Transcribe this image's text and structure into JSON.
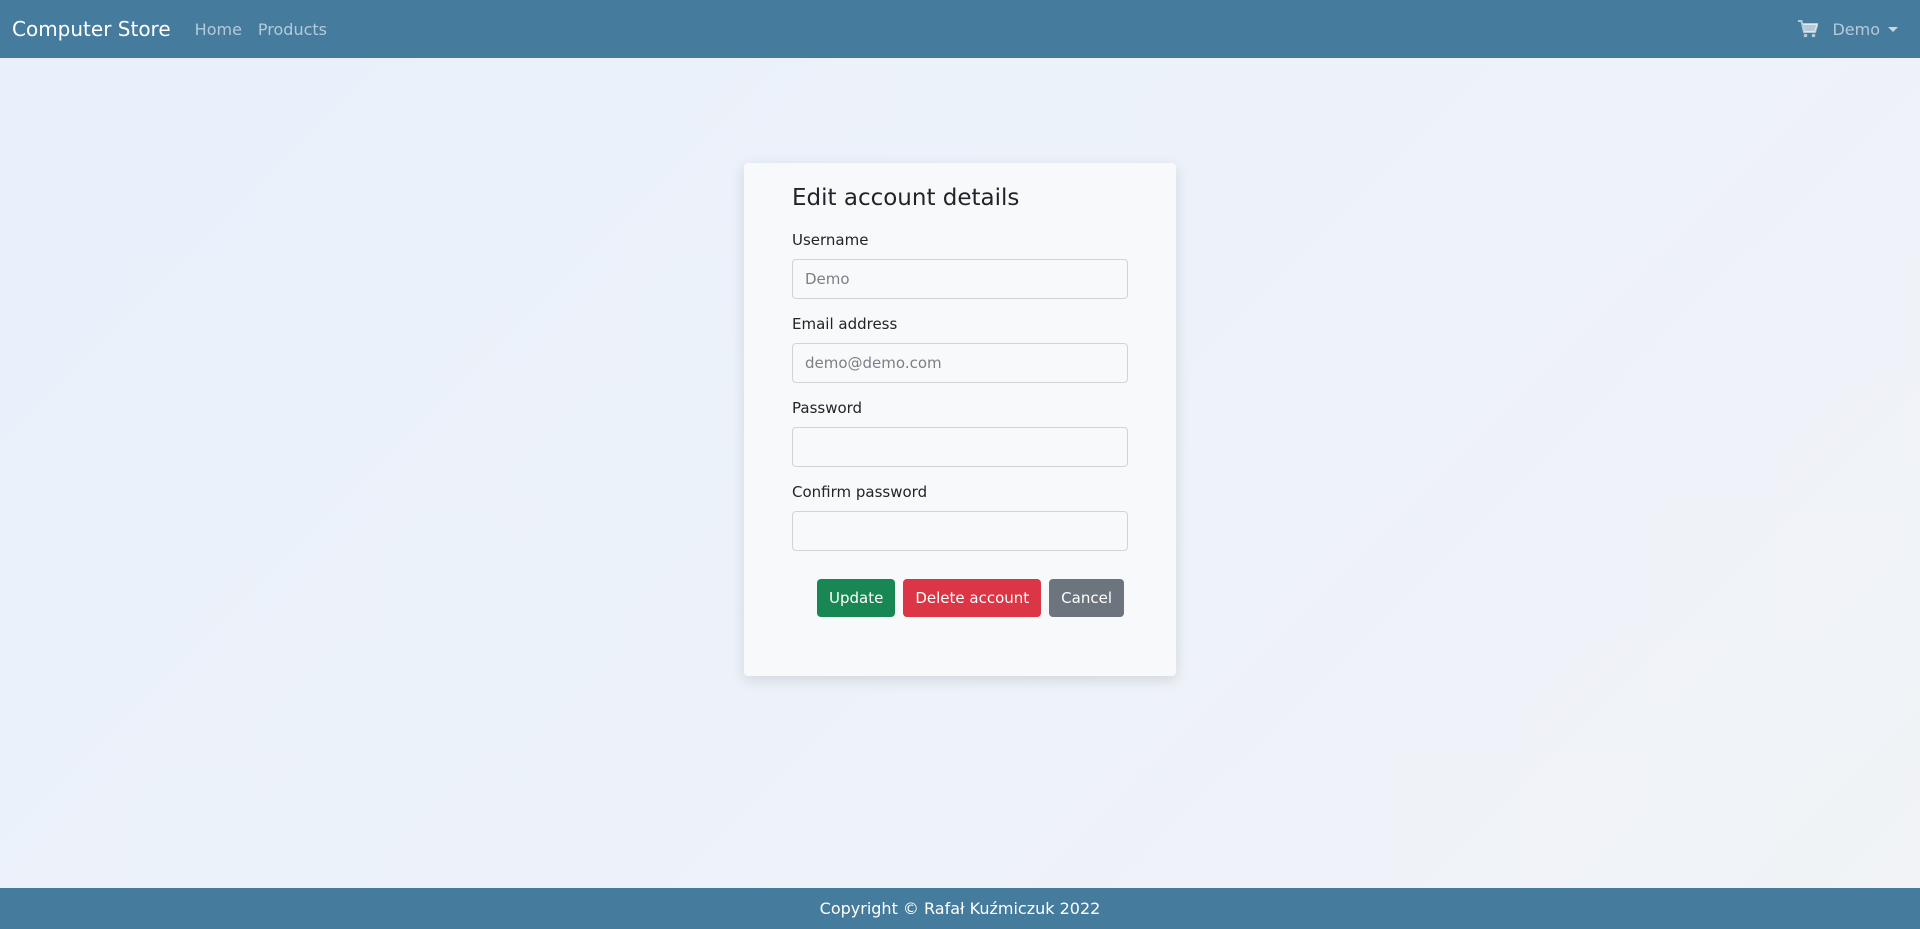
{
  "navbar": {
    "brand": "Computer Store",
    "links": [
      {
        "label": "Home"
      },
      {
        "label": "Products"
      }
    ],
    "cart_icon": "shopping-cart-icon",
    "user_menu": "Demo"
  },
  "form": {
    "title": "Edit account details",
    "username": {
      "label": "Username",
      "placeholder": "Demo",
      "value": ""
    },
    "email": {
      "label": "Email address",
      "placeholder": "demo@demo.com",
      "value": ""
    },
    "password": {
      "label": "Password",
      "placeholder": "",
      "value": ""
    },
    "confirm_password": {
      "label": "Confirm password",
      "placeholder": "",
      "value": ""
    },
    "buttons": {
      "update": "Update",
      "delete": "Delete account",
      "cancel": "Cancel"
    }
  },
  "footer": {
    "copyright": "Copyright © Rafał Kuźmiczuk 2022"
  },
  "colors": {
    "navbar_bg": "#457b9d",
    "update": "#198754",
    "delete": "#dc3545",
    "cancel": "#6c757d"
  }
}
